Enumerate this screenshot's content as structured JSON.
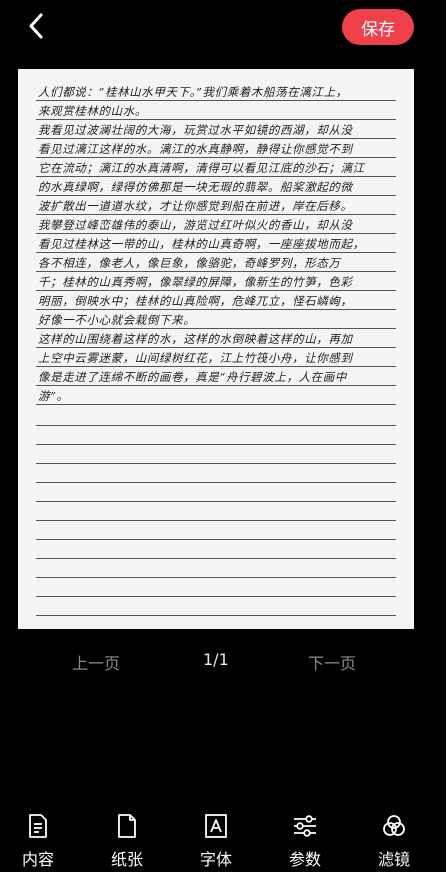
{
  "header": {
    "back_icon": "chevron-left-icon",
    "save_label": "保存",
    "accent_color": "#f0414a"
  },
  "paper": {
    "rows": [
      "人们都说：“桂林山水甲天下。”我们乘着木船荡在漓江上，",
      "来观赏桂林的山水。",
      "我看见过波澜壮阔的大海，玩赏过水平如镜的西湖，却从没",
      "看见过漓江这样的水。漓江的水真静啊，静得让你感觉不到",
      "它在流动；漓江的水真清啊，清得可以看见江底的沙石；漓江",
      "的水真绿啊，绿得仿佛那是一块无瑕的翡翠。船桨激起的微",
      "波扩散出一道道水纹，才让你感觉到船在前进，岸在后移。",
      "我攀登过峰峦雄伟的泰山，游览过红叶似火的香山，却从没",
      "看见过桂林这一带的山，桂林的山真奇啊，一座座拔地而起，",
      "各不相连，像老人，像巨象，像骆驼，奇峰罗列，形态万",
      "千；桂林的山真秀啊，像翠绿的屏障，像新生的竹笋，色彩",
      "明丽，倒映水中；桂林的山真险啊，危峰兀立，怪石嶙峋，",
      "好像一不小心就会栽倒下来。",
      "这样的山围绕着这样的水，这样的水倒映着这样的山，再加",
      "上空中云雾迷蒙，山间绿树红花，江上竹筏小舟，让你感到",
      "像是走进了连绵不断的画卷，真是“舟行碧波上，人在画中",
      "游”。"
    ]
  },
  "pager": {
    "prev_label": "上一页",
    "page_indicator": "1/1",
    "next_label": "下一页"
  },
  "bottom_nav": {
    "items": [
      {
        "icon": "document-icon",
        "label": "内容"
      },
      {
        "icon": "paper-icon",
        "label": "纸张"
      },
      {
        "icon": "font-icon",
        "label": "字体"
      },
      {
        "icon": "sliders-icon",
        "label": "参数"
      },
      {
        "icon": "filter-icon",
        "label": "滤镜"
      }
    ]
  }
}
